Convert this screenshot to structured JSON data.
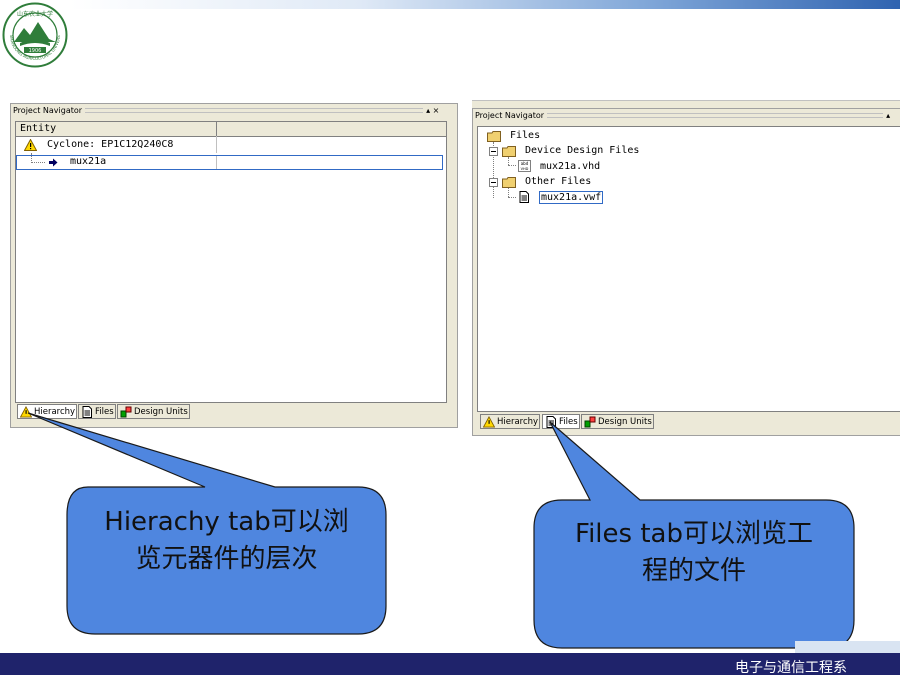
{
  "left_panel": {
    "title": "Project Navigator",
    "controls": "▴ ×",
    "column_header": "Entity",
    "rows": [
      {
        "label": "Cyclone: EP1C12Q240C8",
        "icon": "warning-icon"
      },
      {
        "label": "mux21a",
        "icon": "arrow-icon"
      }
    ],
    "tabs": [
      {
        "label": "Hierarchy",
        "icon": "warning-icon",
        "active": true
      },
      {
        "label": "Files",
        "icon": "file-icon",
        "active": false
      },
      {
        "label": "Design Units",
        "icon": "design-units-icon",
        "active": false
      }
    ]
  },
  "right_panel": {
    "title": "Project Navigator",
    "controls": "▴",
    "tree": [
      {
        "label": "Files",
        "icon": "folder-icon"
      },
      {
        "label": "Device Design Files",
        "icon": "folder-icon"
      },
      {
        "label": "mux21a.vhd",
        "icon": "vhdl-file-icon"
      },
      {
        "label": "Other Files",
        "icon": "folder-icon"
      },
      {
        "label": "mux21a.vwf",
        "icon": "file-icon"
      }
    ],
    "tabs": [
      {
        "label": "Hierarchy",
        "icon": "warning-icon",
        "active": false
      },
      {
        "label": "Files",
        "icon": "file-icon",
        "active": true
      },
      {
        "label": "Design Units",
        "icon": "design-units-icon",
        "active": false
      }
    ]
  },
  "callouts": {
    "left": [
      "Hierachy tab可以浏",
      "览元器件的层次"
    ],
    "right": [
      "Files tab可以浏览工",
      "程的文件"
    ]
  },
  "footer": {
    "text": "电子与通信工程系"
  },
  "logo": {
    "text_top": "山东农业大学",
    "text_ring": "SHANDONG AGRICULTURAL UNIVERSITY",
    "year": "1906"
  },
  "colors": {
    "callout_fill": "#4f86df",
    "callout_stroke": "#1a1a1a",
    "footer_bg": "#1f236b",
    "selection": "#316ac5"
  }
}
